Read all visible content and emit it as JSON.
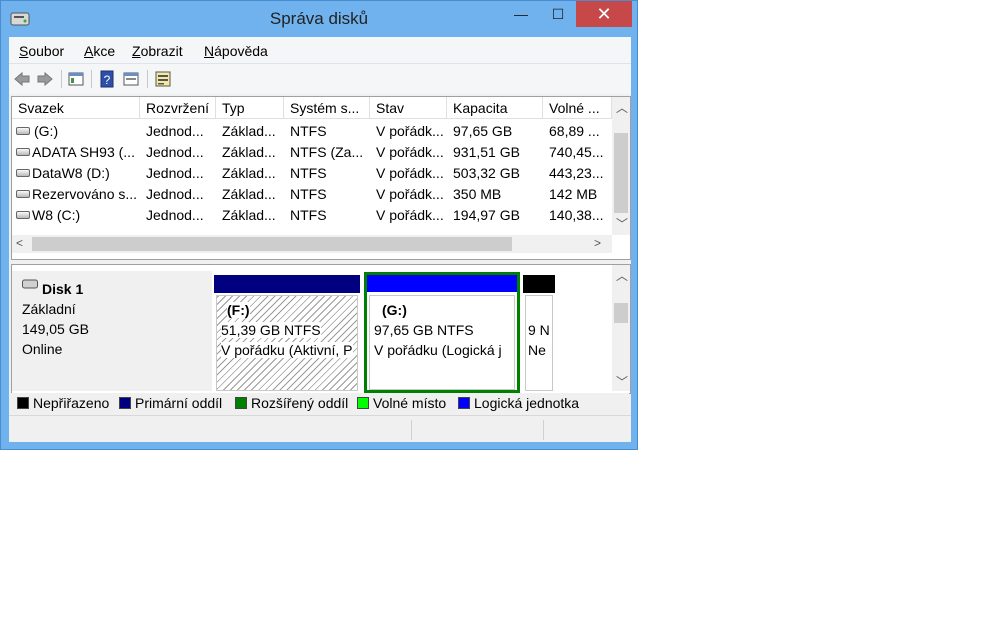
{
  "window": {
    "title": "Správa disků",
    "minimize_glyph": "—",
    "maximize_glyph": "☐",
    "close_glyph": "✕"
  },
  "menu": {
    "items": [
      "Soubor",
      "Akce",
      "Zobrazit",
      "Nápověda"
    ]
  },
  "toolbar": {
    "icons": [
      "back-arrow-icon",
      "forward-arrow-icon",
      "properties-icon",
      "help-icon",
      "view-icon",
      "settings-icon"
    ]
  },
  "volumes": {
    "columns": [
      "Svazek",
      "Rozvržení",
      "Typ",
      "Systém s...",
      "Stav",
      "Kapacita",
      "Volné ..."
    ],
    "rows": [
      [
        "(G:)",
        "Jednod...",
        "Základ...",
        "NTFS",
        "V pořádk...",
        "97,65 GB",
        "68,89 ..."
      ],
      [
        "ADATA SH93 (...",
        "Jednod...",
        "Základ...",
        "NTFS (Za...",
        "V pořádk...",
        "931,51 GB",
        "740,45..."
      ],
      [
        "DataW8 (D:)",
        "Jednod...",
        "Základ...",
        "NTFS",
        "V pořádk...",
        "503,32 GB",
        "443,23..."
      ],
      [
        "Rezervováno s...",
        "Jednod...",
        "Základ...",
        "NTFS",
        "V pořádk...",
        "350 MB",
        "142 MB"
      ],
      [
        "W8 (C:)",
        "Jednod...",
        "Základ...",
        "NTFS",
        "V pořádk...",
        "194,97 GB",
        "140,38..."
      ]
    ]
  },
  "disk": {
    "name": "Disk 1",
    "type": "Základní",
    "size": "149,05 GB",
    "status": "Online",
    "partitions": [
      {
        "letter": "(F:)",
        "size": "51,39 GB NTFS",
        "status": "V pořádku (Aktivní, P",
        "color": "#000080"
      },
      {
        "letter": "(G:)",
        "size": "97,65 GB NTFS",
        "status": "V pořádku (Logická j",
        "color": "#0000ff"
      },
      {
        "letter": "",
        "size": "9 N",
        "status": "Ne",
        "color": "#000000"
      }
    ]
  },
  "legend": {
    "items": [
      {
        "label": "Nepřiřazeno",
        "color": "#000000"
      },
      {
        "label": "Primární oddíl",
        "color": "#000080"
      },
      {
        "label": "Rozšířený oddíl",
        "color": "#008000"
      },
      {
        "label": "Volné místo",
        "color": "#00ff00"
      },
      {
        "label": "Logická jednotka",
        "color": "#0000ff"
      }
    ]
  }
}
